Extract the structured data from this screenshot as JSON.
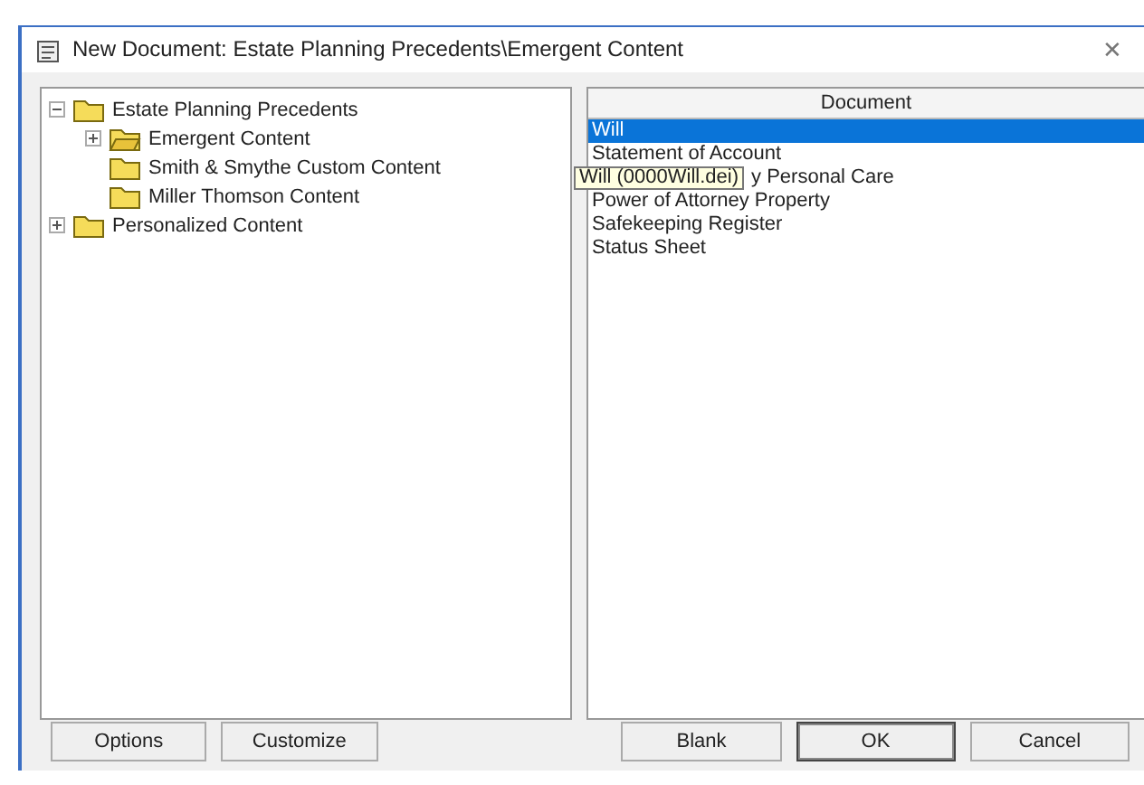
{
  "window": {
    "title": "New Document: Estate Planning Precedents\\Emergent Content",
    "close": "✕"
  },
  "tree": [
    {
      "label": "Estate Planning Precedents",
      "expanded": true,
      "selected": false,
      "children": [
        {
          "label": "Emergent Content",
          "expanded": false,
          "selected": true
        },
        {
          "label": "Smith & Smythe Custom Content",
          "selected": false
        },
        {
          "label": "Miller Thomson Content",
          "selected": false
        }
      ]
    },
    {
      "label": "Personalized Content",
      "expanded": false,
      "selected": false
    }
  ],
  "document_list": {
    "column": "Document",
    "rows": [
      {
        "text": "Will",
        "selected": true
      },
      {
        "text": "Statement of Account",
        "selected": false
      },
      {
        "text": "y Personal Care",
        "selected": false,
        "tooltip": "Will (0000Will.dei)"
      },
      {
        "text": "Power of Attorney Property",
        "selected": false
      },
      {
        "text": "Safekeeping Register",
        "selected": false
      },
      {
        "text": "Status Sheet",
        "selected": false
      }
    ]
  },
  "buttons_left": [
    "Options",
    "Customize"
  ],
  "buttons_right": [
    {
      "label": "Blank",
      "default": false
    },
    {
      "label": "OK",
      "default": true
    },
    {
      "label": "Cancel",
      "default": false
    }
  ]
}
